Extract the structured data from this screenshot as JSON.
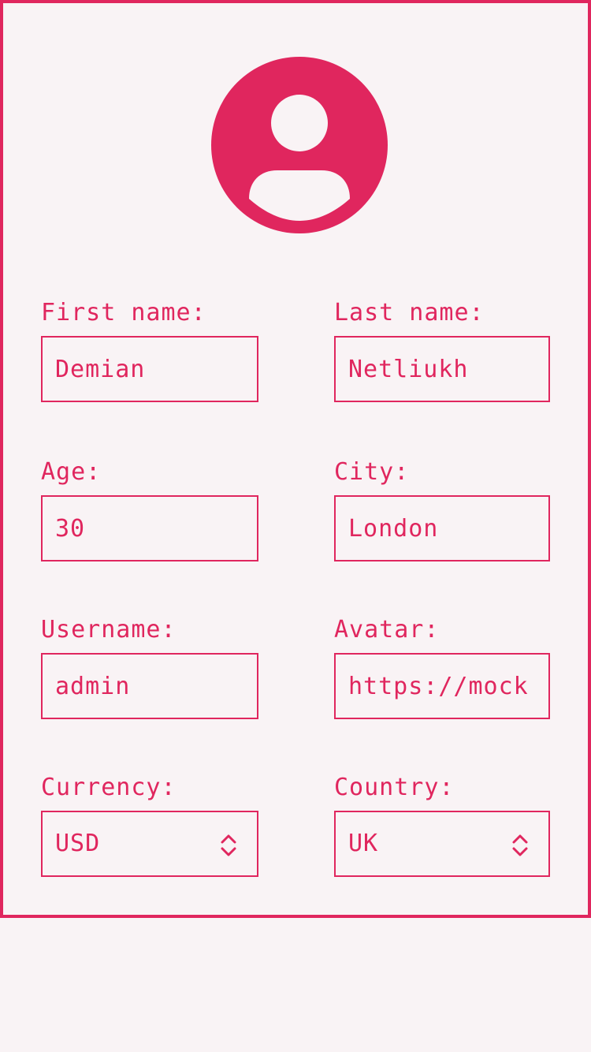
{
  "avatar": {
    "icon": "user-circle-icon"
  },
  "fields": {
    "first_name": {
      "label": "First name:",
      "value": "Demian"
    },
    "last_name": {
      "label": "Last name:",
      "value": "Netliukh"
    },
    "age": {
      "label": "Age:",
      "value": "30"
    },
    "city": {
      "label": "City:",
      "value": "London"
    },
    "username": {
      "label": "Username:",
      "value": "admin"
    },
    "avatar": {
      "label": "Avatar:",
      "value": "https://mock"
    },
    "currency": {
      "label": "Currency:",
      "value": "USD"
    },
    "country": {
      "label": "Country:",
      "value": "UK"
    }
  },
  "colors": {
    "accent": "#e0265e",
    "background": "#f9f3f5"
  }
}
